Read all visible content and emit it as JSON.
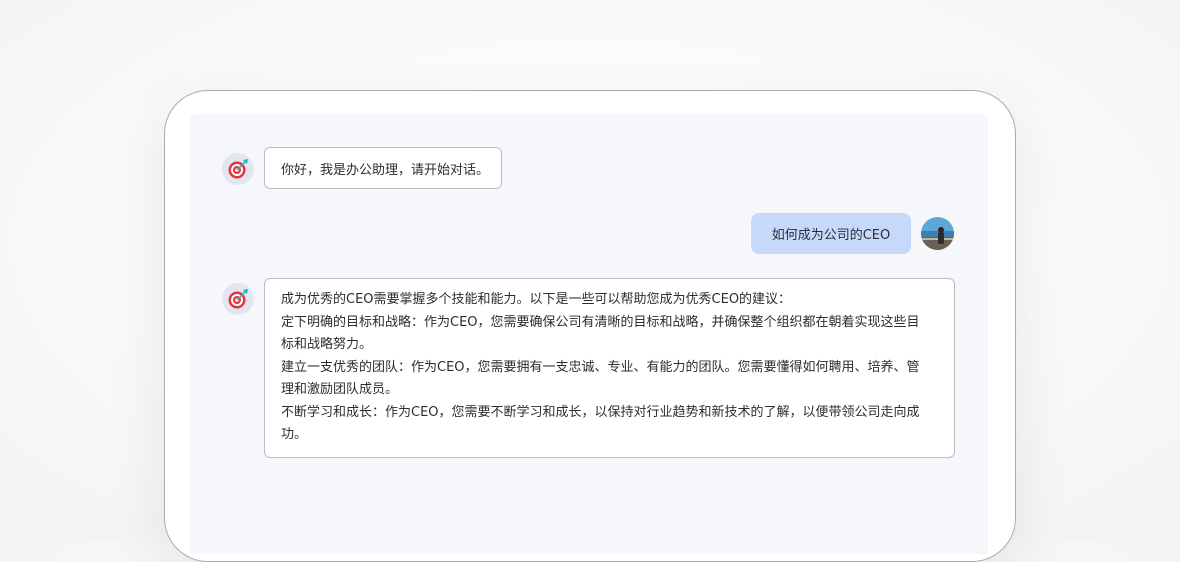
{
  "chat": {
    "greeting": "你好，我是办公助理，请开始对话。",
    "user_question": "如何成为公司的CEO",
    "answer_lines": [
      "成为优秀的CEO需要掌握多个技能和能力。以下是一些可以帮助您成为优秀CEO的建议：",
      "定下明确的目标和战略：作为CEO，您需要确保公司有清晰的目标和战略，并确保整个组织都在朝着实现这些目",
      "标和战略努力。",
      "建立一支优秀的团队：作为CEO，您需要拥有一支忠诚、专业、有能力的团队。您需要懂得如何聘用、培养、管",
      "理和激励团队成员。",
      "不断学习和成长：作为CEO，您需要不断学习和成长，以保持对行业趋势和新技术的了解，以便带领公司走向成",
      "功。"
    ]
  },
  "icons": {
    "bot_avatar": "dartboard-icon",
    "user_avatar": "user-photo"
  },
  "colors": {
    "user_bubble": "#c6d9fb",
    "screen_bg": "#f5f7fb",
    "dart_red": "#e0363c",
    "dart_teal": "#27b5c7"
  }
}
